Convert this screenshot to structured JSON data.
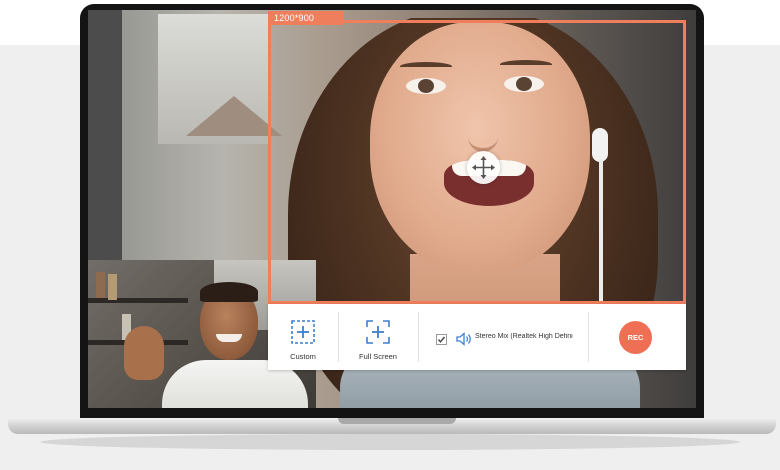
{
  "capture": {
    "size_label": "1200*900"
  },
  "toolbar": {
    "custom_label": "Custom",
    "fullscreen_label": "Full Screen",
    "audio_checked": true,
    "audio_source_label": "Stereo Mix (Realtek High Defini",
    "record_label": "REC"
  },
  "colors": {
    "accent": "#ee7e5c",
    "icon_blue": "#3d7fd0",
    "record": "#ef6f55"
  },
  "icons": [
    "custom-region-icon",
    "full-screen-icon",
    "checkbox-icon",
    "speaker-icon",
    "move-icon"
  ]
}
